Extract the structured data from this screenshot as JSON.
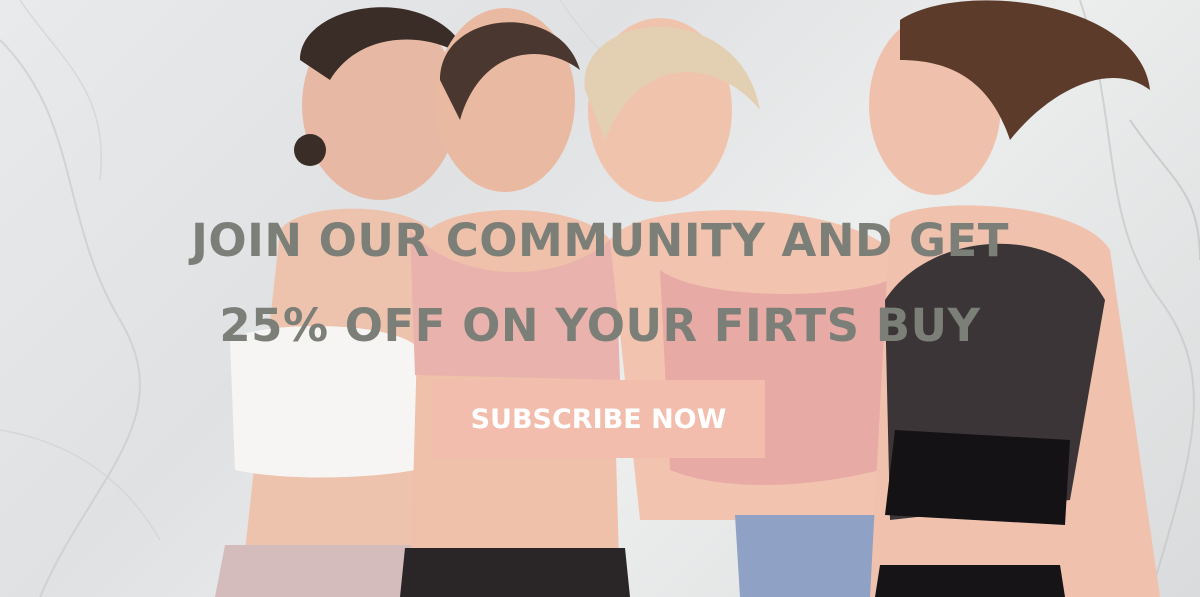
{
  "hero": {
    "headline_line1": "JOIN OUR COMMUNITY AND GET",
    "headline_line2": "25% OFF ON YOUR FIRTS BUY",
    "cta_label": "SUBSCRIBE NOW",
    "background_image": "group-of-four-women-in-sportswear-photo"
  },
  "colors": {
    "headline_text": "#7b7f78",
    "cta_background": "#f2bdac",
    "cta_text": "#ffffff"
  }
}
